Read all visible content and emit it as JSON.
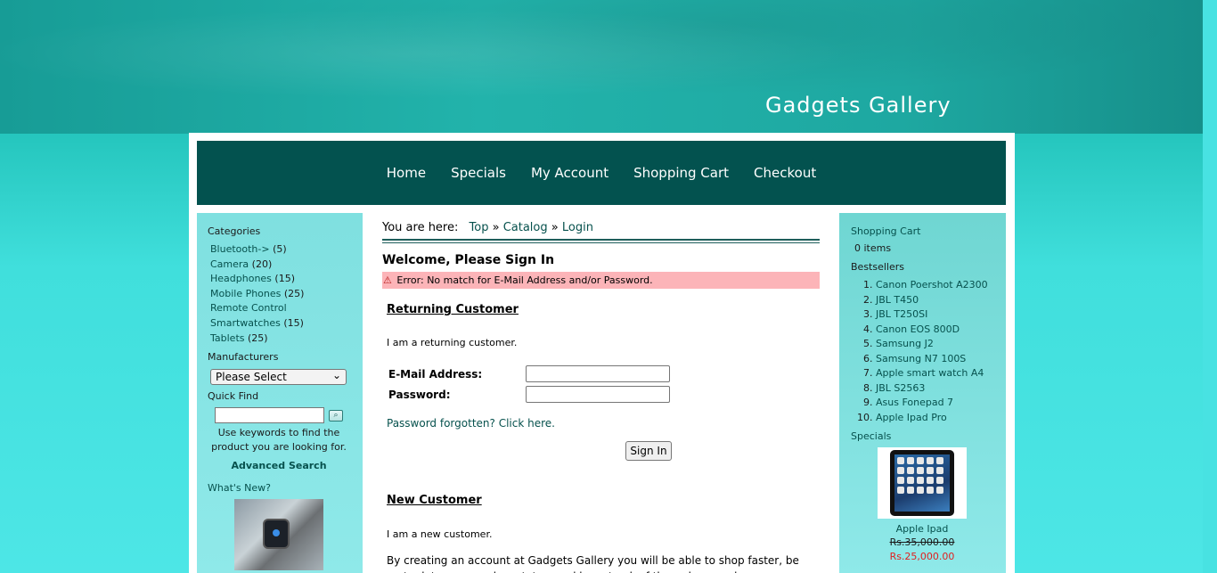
{
  "site": {
    "title": "Gadgets Gallery"
  },
  "nav": [
    "Home",
    "Specials",
    "My Account",
    "Shopping Cart",
    "Checkout"
  ],
  "left": {
    "categories_title": "Categories",
    "categories": [
      {
        "name": "Bluetooth->",
        "count": "(5)"
      },
      {
        "name": "Camera",
        "count": "(20)"
      },
      {
        "name": "Headphones",
        "count": "(15)"
      },
      {
        "name": "Mobile Phones",
        "count": "(25)"
      },
      {
        "name": "Remote Control",
        "count": ""
      },
      {
        "name": "Smartwatches",
        "count": "(15)"
      },
      {
        "name": "Tablets",
        "count": "(25)"
      }
    ],
    "manufacturers_title": "Manufacturers",
    "manufacturers_select": "Please Select",
    "quickfind_title": "Quick Find",
    "quickfind_text": "Use keywords to find the product you are looking for.",
    "advanced_search": "Advanced Search",
    "whats_new_title": "What's New?"
  },
  "center": {
    "breadcrumb_label": "You are here:",
    "breadcrumb": [
      "Top",
      "Catalog",
      "Login"
    ],
    "heading": "Welcome, Please Sign In",
    "error": "Error: No match for E-Mail Address and/or Password.",
    "returning_title": "Returning Customer",
    "returning_text": "I am a returning customer.",
    "email_label": "E-Mail Address:",
    "password_label": "Password:",
    "password_forgotten": "Password forgotten? Click here.",
    "signin_button": "Sign In",
    "new_title": "New Customer",
    "new_text": "I am a new customer.",
    "new_paragraph": "By creating an account at Gadgets Gallery you will be able to shop faster, be up to date on an orders status, and keep track of the orders you have previously made."
  },
  "right": {
    "cart_title": "Shopping Cart",
    "cart_items": "0 items",
    "bestsellers_title": "Bestsellers",
    "bestsellers": [
      "Canon Poershot A2300",
      "JBL T450",
      "JBL T250SI",
      "Canon EOS 800D",
      "Samsung J2",
      "Samsung N7 100S",
      "Apple smart watch A4",
      "JBL S2563",
      "Asus Fonepad 7",
      "Apple Ipad Pro"
    ],
    "specials_title": "Specials",
    "special_name": "Apple Ipad",
    "special_old_price": "Rs.35,000.00",
    "special_new_price": "Rs.25,000.00"
  }
}
